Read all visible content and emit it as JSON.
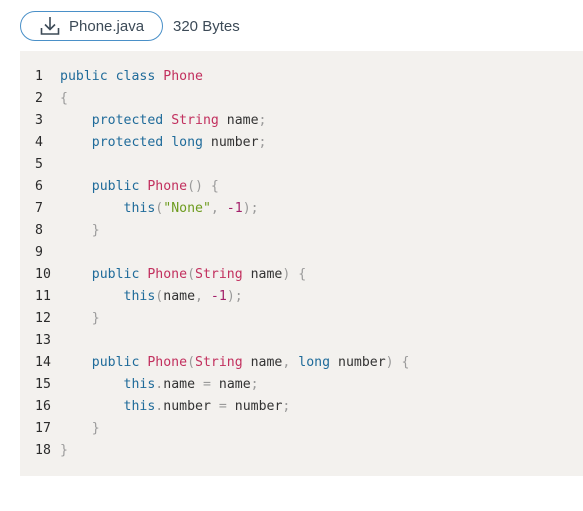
{
  "file": {
    "download_label": "Phone.java",
    "download_icon": "download-icon",
    "size": "320 Bytes"
  },
  "code": {
    "language": "java",
    "lines": [
      "public class Phone",
      "{",
      "    protected String name;",
      "    protected long number;",
      "",
      "    public Phone() {",
      "        this(\"None\", -1);",
      "    }",
      "",
      "    public Phone(String name) {",
      "        this(name, -1);",
      "    }",
      "",
      "    public Phone(String name, long number) {",
      "        this.name = name;",
      "        this.number = number;",
      "    }",
      "}"
    ]
  },
  "colors": {
    "border_accent": "#4a90c8",
    "code_background": "#f3f1ee",
    "keyword": "#1f6b9a",
    "type": "#c2305e",
    "string": "#6e9c1f",
    "number": "#a2206a",
    "punctuation": "#9a9a9a"
  }
}
